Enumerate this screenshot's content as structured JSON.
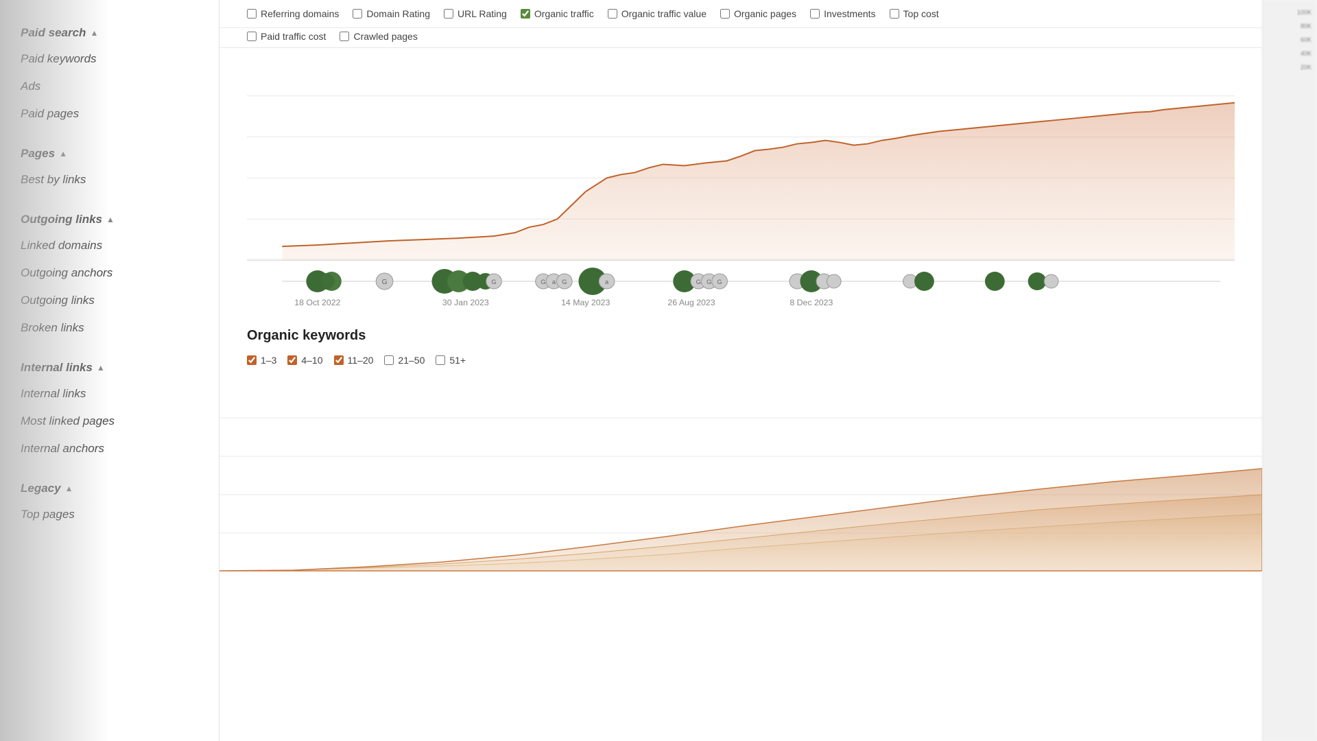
{
  "sidebar": {
    "sections": [
      {
        "title": "Paid search",
        "arrow": "▲",
        "items": [
          "Paid keywords",
          "Ads",
          "Paid pages"
        ]
      },
      {
        "title": "Pages",
        "arrow": "▲",
        "items": [
          "Best by links"
        ]
      },
      {
        "title": "Outgoing links",
        "arrow": "▲",
        "items": [
          "Linked domains",
          "Outgoing anchors",
          "Outgoing links",
          "Broken links"
        ]
      },
      {
        "title": "Internal links",
        "arrow": "▲",
        "items": [
          "Internal links",
          "Most linked pages",
          "Internal anchors"
        ]
      },
      {
        "title": "Legacy",
        "arrow": "▲",
        "items": [
          "Top pages"
        ]
      }
    ]
  },
  "filters": {
    "row1": [
      {
        "label": "Referring domains",
        "checked": false,
        "id": "ref-domains"
      },
      {
        "label": "Domain Rating",
        "checked": false,
        "id": "domain-rating"
      },
      {
        "label": "URL Rating",
        "checked": false,
        "id": "url-rating"
      },
      {
        "label": "Organic traffic",
        "checked": true,
        "id": "organic-traffic"
      },
      {
        "label": "Organic traffic value",
        "checked": false,
        "id": "organic-traffic-value"
      },
      {
        "label": "Organic pages",
        "checked": false,
        "id": "organic-pages"
      },
      {
        "label": "Investments",
        "checked": false,
        "id": "investments"
      },
      {
        "label": "Top cost",
        "checked": false,
        "id": "top-cost"
      }
    ],
    "row2": [
      {
        "label": "Paid traffic cost",
        "checked": false,
        "id": "paid-traffic"
      },
      {
        "label": "Crawled pages",
        "checked": false,
        "id": "crawled-pages"
      }
    ]
  },
  "timeline_labels": [
    "18 Oct 2022",
    "30 Jan 2023",
    "14 May 2023",
    "26 Aug 2023",
    "8 Dec 2023",
    "",
    "",
    "",
    ""
  ],
  "organic_keywords_section": {
    "title": "Organic keywords",
    "filters": [
      {
        "label": "1–3",
        "checked": true
      },
      {
        "label": "4–10",
        "checked": true
      },
      {
        "label": "11–20",
        "checked": true
      },
      {
        "label": "21–50",
        "checked": false
      },
      {
        "label": "51+",
        "checked": false
      }
    ]
  },
  "chart": {
    "accent_color": "#c0622a",
    "fill_color": "rgba(192, 98, 42, 0.15)"
  }
}
